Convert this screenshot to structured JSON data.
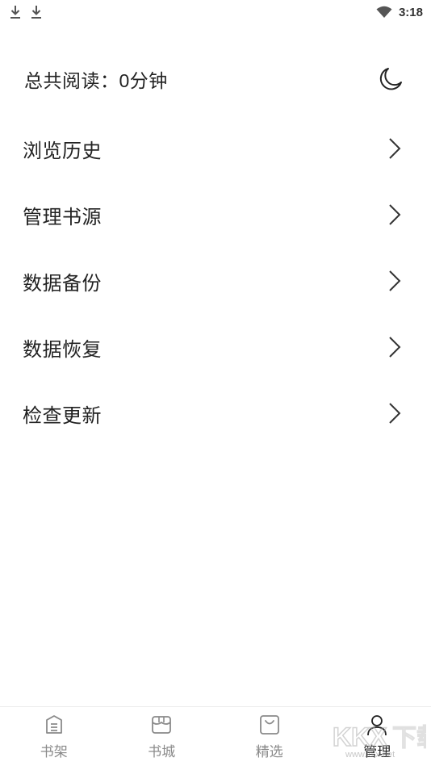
{
  "status_bar": {
    "time": "3:18",
    "icons": [
      "download-icon",
      "download-icon",
      "wifi-icon"
    ]
  },
  "reading": {
    "label": "总共阅读：",
    "value": "0分钟",
    "theme_icon": "moon-icon"
  },
  "menu": {
    "items": [
      {
        "label": "浏览历史",
        "icon": "chevron-right-icon"
      },
      {
        "label": "管理书源",
        "icon": "chevron-right-icon"
      },
      {
        "label": "数据备份",
        "icon": "chevron-right-icon"
      },
      {
        "label": "数据恢复",
        "icon": "chevron-right-icon"
      },
      {
        "label": "检查更新",
        "icon": "chevron-right-icon"
      }
    ]
  },
  "bottom_nav": {
    "items": [
      {
        "label": "书架",
        "icon": "bookshelf-icon",
        "active": false
      },
      {
        "label": "书城",
        "icon": "store-icon",
        "active": false
      },
      {
        "label": "精选",
        "icon": "bag-icon",
        "active": false
      },
      {
        "label": "管理",
        "icon": "user-icon",
        "active": true
      }
    ]
  },
  "colors": {
    "text_primary": "#222222",
    "text_inactive": "#8a8a8a",
    "divider": "#ececec",
    "background": "#ffffff"
  },
  "watermark": {
    "brand": "KKX下载",
    "url": "www.kkx.net"
  }
}
